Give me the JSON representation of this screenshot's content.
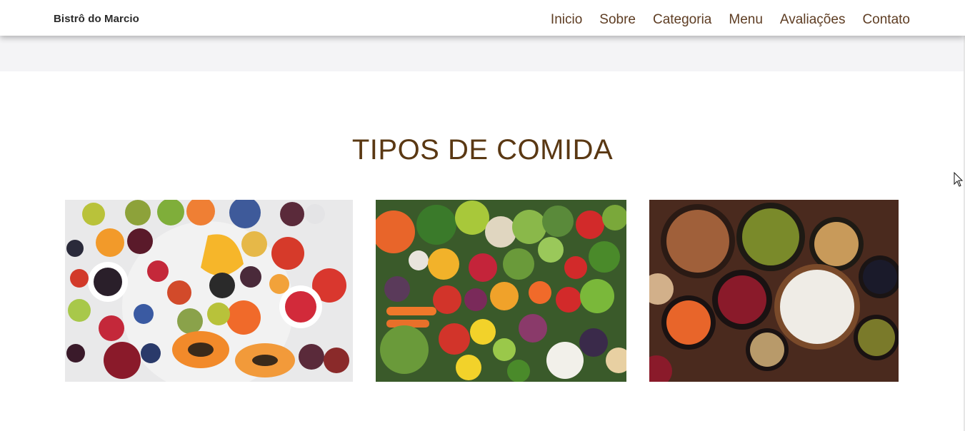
{
  "header": {
    "brand": "Bistrô do Marcio",
    "nav": [
      {
        "label": "Inicio"
      },
      {
        "label": "Sobre"
      },
      {
        "label": "Categoria"
      },
      {
        "label": "Menu"
      },
      {
        "label": "Avaliações"
      },
      {
        "label": "Contato"
      }
    ]
  },
  "section": {
    "title": "TIPOS DE COMIDA",
    "cards": [
      {
        "image": "fruits-photo"
      },
      {
        "image": "vegetables-photo"
      },
      {
        "image": "legumes-photo"
      }
    ]
  },
  "colors": {
    "nav_text": "#5e3d23",
    "title_text": "#5a3813",
    "brand_text": "#2b2b2b"
  }
}
